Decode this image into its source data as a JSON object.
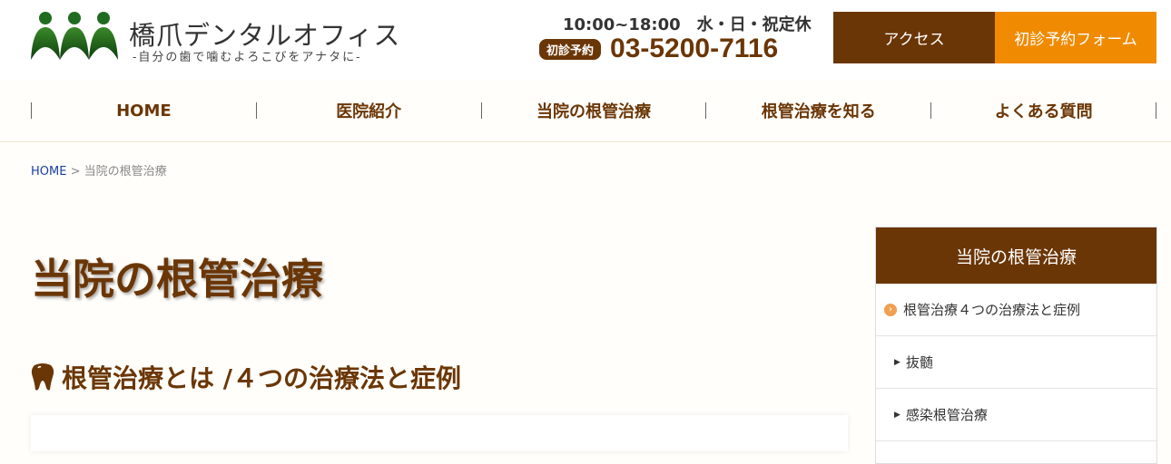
{
  "header": {
    "clinic_name": "橋爪デンタルオフィス",
    "tagline": "-自分の歯で噛むよろこびをアナタに-",
    "hours": "10:00~18:00　水・日・祝定休",
    "phone_badge": "初診予約",
    "phone_number": "03-5200-7116",
    "access_label": "アクセス",
    "form_label": "初診予約フォーム"
  },
  "nav": {
    "items": [
      {
        "label": "HOME"
      },
      {
        "label": "医院紹介"
      },
      {
        "label": "当院の根管治療"
      },
      {
        "label": "根管治療を知る"
      },
      {
        "label": "よくある質問"
      }
    ]
  },
  "breadcrumb": {
    "home": "HOME",
    "separator": " > ",
    "current": "当院の根管治療"
  },
  "main": {
    "title": "当院の根管治療",
    "section_heading": "根管治療とは /４つの治療法と症例"
  },
  "sidebar": {
    "title": "当院の根管治療",
    "items": [
      {
        "label": "根管治療４つの治療法と症例"
      },
      {
        "label": "抜髄"
      },
      {
        "label": "感染根管治療"
      }
    ]
  },
  "colors": {
    "brand_brown": "#6b3606",
    "accent_orange": "#f08a00",
    "logo_green": "#1f6b1f"
  }
}
